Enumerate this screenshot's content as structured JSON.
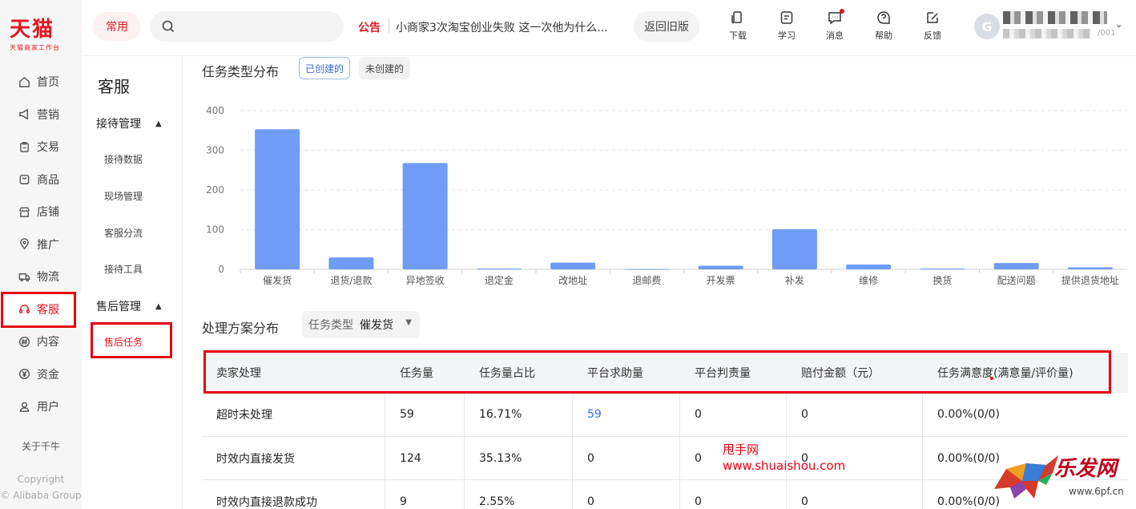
{
  "logo": {
    "text": "天猫",
    "sub": "天猫商家工作台"
  },
  "leftnav": {
    "items": [
      {
        "label": "首页",
        "icon": "home-icon"
      },
      {
        "label": "营销",
        "icon": "megaphone-icon"
      },
      {
        "label": "交易",
        "icon": "clipboard-icon"
      },
      {
        "label": "商品",
        "icon": "bag-icon"
      },
      {
        "label": "店铺",
        "icon": "store-icon"
      },
      {
        "label": "推广",
        "icon": "location-icon"
      },
      {
        "label": "物流",
        "icon": "truck-icon"
      },
      {
        "label": "客服",
        "icon": "headset-icon",
        "active": true
      },
      {
        "label": "内容",
        "icon": "hash-icon"
      },
      {
        "label": "资金",
        "icon": "yuan-icon"
      },
      {
        "label": "用户",
        "icon": "user-icon"
      }
    ],
    "about": "关于千牛",
    "copyright_line1": "Copyright",
    "copyright_line2": "© Alibaba Group"
  },
  "subnav": {
    "title": "客服",
    "group1": "接待管理",
    "group1_items": [
      "接待数据",
      "现场管理",
      "客服分流",
      "接待工具"
    ],
    "group2": "售后管理",
    "group2_items": [
      "售后任务"
    ]
  },
  "header": {
    "common_label": "常用",
    "search_placeholder": "",
    "notice_tag": "公告",
    "notice_text": "小商家3次淘宝创业失败 这一次他为什么...",
    "old_version_label": "返回旧版",
    "tools": [
      "下载",
      "学习",
      "消息",
      "帮助",
      "反馈"
    ],
    "avatar_letter": "G",
    "user_id_suffix": "/001"
  },
  "task_dist": {
    "title": "任务类型分布",
    "tab_on": "已创建的",
    "tab_off": "未创建的"
  },
  "chart_data": {
    "type": "bar",
    "categories": [
      "催发货",
      "退货/退款",
      "异地签收",
      "退定金",
      "改地址",
      "退邮费",
      "开发票",
      "补发",
      "维修",
      "换货",
      "配送问题",
      "提供退货地址"
    ],
    "values": [
      353,
      30,
      268,
      2,
      17,
      1,
      9,
      101,
      12,
      2,
      16,
      5
    ],
    "yticks": [
      0,
      100,
      200,
      300,
      400
    ],
    "ylim": [
      0,
      400
    ],
    "grid": true,
    "color": "#6e9cf7"
  },
  "plan_dist": {
    "title": "处理方案分布",
    "select_label": "任务类型",
    "select_value": "催发货"
  },
  "table": {
    "headers": [
      "卖家处理",
      "任务量",
      "任务量占比",
      "平台求助量",
      "平台判责量",
      "赔付金额（元）",
      "任务满意度(满意量/评价量)"
    ],
    "rows": [
      [
        "超时未处理",
        "59",
        "16.71%",
        "59",
        "0",
        "0",
        "0.00%(0/0)"
      ],
      [
        "时效内直接发货",
        "124",
        "35.13%",
        "0",
        "0",
        "0",
        "0.00%(0/0)"
      ],
      [
        "时效内直接退款成功",
        "9",
        "2.55%",
        "0",
        "0",
        "0",
        "0.00%(0/0)"
      ]
    ]
  },
  "watermark": {
    "line1": "甩手网",
    "line2": "www.shuaishou.com",
    "logo_text": "乐发网",
    "logo_url": "www.6pf.cn"
  }
}
